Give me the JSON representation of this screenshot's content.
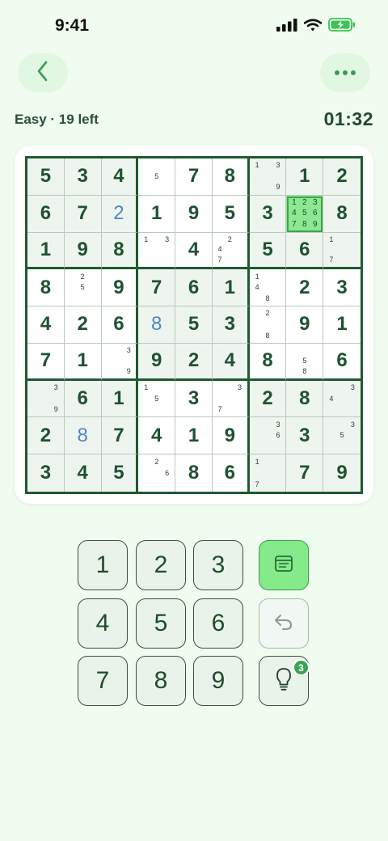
{
  "status": {
    "time": "9:41"
  },
  "header": {
    "back_icon": "chevron-left-icon",
    "more_icon": "more-horizontal-icon",
    "difficulty": "Easy · 19 left",
    "timer": "01:32"
  },
  "board": {
    "cells": [
      [
        {
          "v": "5"
        },
        {
          "v": "3"
        },
        {
          "v": "4"
        },
        {
          "n": [
            5
          ]
        },
        {
          "v": "7"
        },
        {
          "v": "8"
        },
        {
          "n": [
            1,
            3,
            9
          ]
        },
        {
          "v": "1"
        },
        {
          "v": "2"
        }
      ],
      [
        {
          "v": "6"
        },
        {
          "v": "7"
        },
        {
          "v": "2",
          "u": true
        },
        {
          "v": "1"
        },
        {
          "v": "9"
        },
        {
          "v": "5"
        },
        {
          "v": "3"
        },
        {
          "n": [
            1,
            2,
            3,
            4,
            5,
            6,
            7,
            8,
            9
          ],
          "sel": true
        },
        {
          "v": "8"
        }
      ],
      [
        {
          "v": "1"
        },
        {
          "v": "9"
        },
        {
          "v": "8"
        },
        {
          "n": [
            1,
            3
          ]
        },
        {
          "v": "4"
        },
        {
          "n": [
            2,
            4,
            7
          ]
        },
        {
          "v": "5"
        },
        {
          "v": "6"
        },
        {
          "n": [
            1,
            7
          ]
        }
      ],
      [
        {
          "v": "8"
        },
        {
          "n": [
            2,
            5
          ]
        },
        {
          "v": "9"
        },
        {
          "v": "7"
        },
        {
          "v": "6"
        },
        {
          "v": "1"
        },
        {
          "n": [
            1,
            4,
            8
          ]
        },
        {
          "v": "2"
        },
        {
          "v": "3"
        }
      ],
      [
        {
          "v": "4"
        },
        {
          "v": "2"
        },
        {
          "v": "6"
        },
        {
          "v": "8",
          "u": true
        },
        {
          "v": "5"
        },
        {
          "v": "3"
        },
        {
          "n": [
            2,
            8
          ]
        },
        {
          "v": "9"
        },
        {
          "v": "1"
        }
      ],
      [
        {
          "v": "7"
        },
        {
          "v": "1"
        },
        {
          "n": [
            3,
            9
          ]
        },
        {
          "v": "9"
        },
        {
          "v": "2"
        },
        {
          "v": "4"
        },
        {
          "v": "8"
        },
        {
          "n": [
            5,
            8
          ]
        },
        {
          "v": "6"
        }
      ],
      [
        {
          "n": [
            3,
            9
          ]
        },
        {
          "v": "6"
        },
        {
          "v": "1"
        },
        {
          "n": [
            1,
            5
          ]
        },
        {
          "v": "3"
        },
        {
          "n": [
            3,
            7
          ]
        },
        {
          "v": "2"
        },
        {
          "v": "8"
        },
        {
          "n": [
            3,
            4
          ]
        }
      ],
      [
        {
          "v": "2"
        },
        {
          "v": "8",
          "u": true
        },
        {
          "v": "7"
        },
        {
          "v": "4"
        },
        {
          "v": "1"
        },
        {
          "v": "9"
        },
        {
          "n": [
            3,
            6
          ]
        },
        {
          "v": "3"
        },
        {
          "n": [
            3,
            5
          ]
        }
      ],
      [
        {
          "v": "3"
        },
        {
          "v": "4"
        },
        {
          "v": "5"
        },
        {
          "n": [
            2,
            6
          ]
        },
        {
          "v": "8"
        },
        {
          "v": "6"
        },
        {
          "n": [
            1,
            7
          ]
        },
        {
          "v": "7"
        },
        {
          "v": "9"
        }
      ]
    ]
  },
  "keypad": {
    "digits": [
      "1",
      "2",
      "3",
      "4",
      "5",
      "6",
      "7",
      "8",
      "9"
    ],
    "notes_icon": "notes-icon",
    "undo_icon": "undo-icon",
    "hint_icon": "lightbulb-icon",
    "hint_count": "3"
  },
  "colors": {
    "background": "#effcef",
    "accent": "#84ea8a",
    "digit": "#1f5230",
    "user_digit": "#4d87c4"
  }
}
